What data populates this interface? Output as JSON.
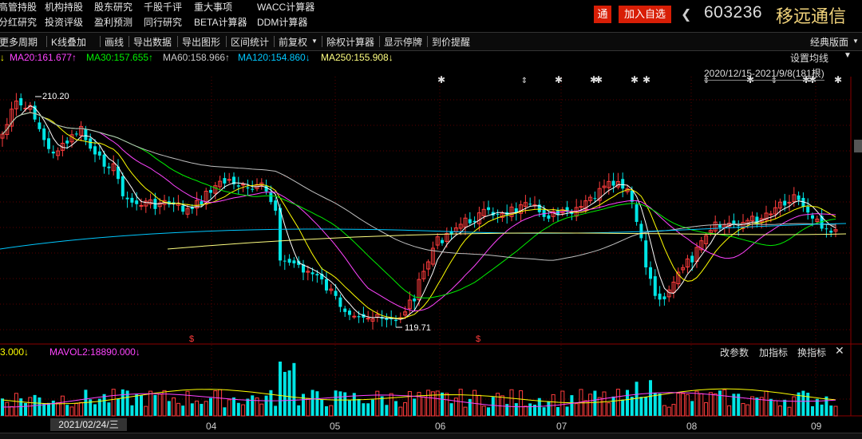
{
  "menu": {
    "row1": [
      "高管持股",
      "机构持股",
      "股东研究",
      "千股千评",
      "重大事项",
      "WACC计算器"
    ],
    "row2": [
      "分红研究",
      "投资评级",
      "盈利预测",
      "同行研究",
      "BETA计算器",
      "DDM计算器"
    ]
  },
  "header": {
    "tong_label": "通",
    "add_watch_label": "加入自选",
    "stock_code": "603236",
    "stock_name": "移远通信"
  },
  "toolbar": {
    "items": [
      "更多周期",
      "K线叠加",
      "画线",
      "导出数据",
      "导出图形",
      "区间统计",
      "前复权",
      "除权计算器",
      "显示停牌",
      "到价提醒"
    ],
    "right_label": "经典版面"
  },
  "ma": {
    "ma20": "MA20:161.677↑",
    "ma30": "MA30:157.655↑",
    "ma60": "MA60:158.966↑",
    "ma120": "MA120:154.860↓",
    "ma250": "MA250:155.908↓",
    "set_label": "设置均线",
    "date_range": "2020/12/15-2021/9/8(181根)"
  },
  "price_annotations": {
    "high": "210.20",
    "low": "119.71"
  },
  "volume": {
    "mavol1": "3.000↓",
    "mavol2": "MAVOL2:18890.000↓",
    "btn_params": "改参数",
    "btn_add": "加指标",
    "btn_switch": "换指标"
  },
  "xaxis": {
    "cursor_date": "2021/02/24/三",
    "months": [
      "04",
      "05",
      "06",
      "07",
      "08",
      "09"
    ]
  },
  "colors": {
    "up": "#ff3c3c",
    "down": "#00e5e5",
    "ma5": "#ffffff",
    "ma10": "#ffff00",
    "ma20": "#ff44ff",
    "ma30": "#00ee00",
    "ma60": "#c0c0c0",
    "ma120": "#00c8ff",
    "ma250": "#ffff80",
    "accent_red": "#d81e06",
    "name_gold": "#f0d27a"
  }
}
